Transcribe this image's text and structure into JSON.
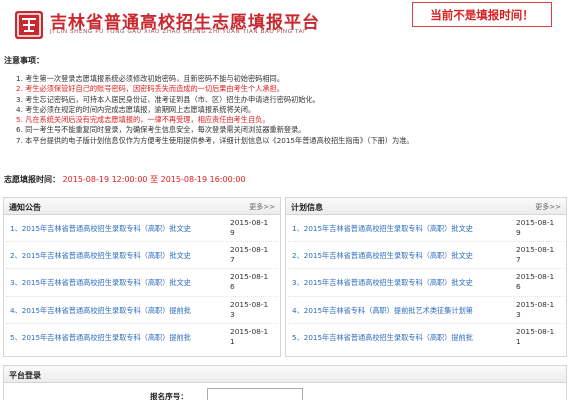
{
  "header": {
    "title": "吉林省普通高校招生志愿填报平台",
    "subtitle": "JI LIN SHENG PU TONG GAO XIAO ZHAO SHENG ZHI YUAN TIAN BAO PING TAI",
    "status_notice": "当前不是填报时间！"
  },
  "notes": {
    "title": "注意事项：",
    "items": [
      {
        "text": "1. 考生第一次登录志愿填报系统必须修改初始密码，且新密码不能与初始密码相同。",
        "red": false
      },
      {
        "text": "2. 考生必须保管好自己的账号密码，因密码丢失而造成的一切后果由考生个人承担。",
        "red": true
      },
      {
        "text": "3. 考生忘记密码后，可持本人居民身份证、准考证到县（市、区）招生办申请进行密码初始化。",
        "red": false
      },
      {
        "text": "4. 考生必须在规定的时间内完成志愿填报，逾期网上志愿填报系统将关闭。",
        "red": false
      },
      {
        "text": "5. 凡在系统关闭后没有完成志愿填报的，一律不再受理，相应责任由考生自负。",
        "red": true
      },
      {
        "text": "6. 同一考生号不能重复同时登录，为确保考生信息安全，每次登录需关闭浏览器重新登录。",
        "red": false
      },
      {
        "text": "7. 本平台提供的电子版计划信息仅作为方便考生使用提供参考，详细计划信息以《2015年普通高校招生指南》（下册）为准。",
        "red": false
      }
    ]
  },
  "period": {
    "label": "志愿填报时间：",
    "start": "2015-08-19 12:00:00",
    "sep": "至",
    "end": "2015-08-19 16:00:00"
  },
  "announcements": {
    "title": "通知公告",
    "more": "更多>>",
    "items": [
      {
        "title": "1、2015年吉林省普通高校招生录取专科（高职）批文史",
        "date": "2015-08-19"
      },
      {
        "title": "2、2015年吉林省普通高校招生录取专科（高职）批文史",
        "date": "2015-08-17"
      },
      {
        "title": "3、2015年吉林省普通高校招生录取专科（高职）批文史",
        "date": "2015-08-16"
      },
      {
        "title": "4、2015年吉林省普通高校招生录取专科（高职）提前批",
        "date": "2015-08-13"
      },
      {
        "title": "5、2015年吉林省普通高校招生录取专科（高职）提前批",
        "date": "2015-08-11"
      }
    ]
  },
  "plans": {
    "title": "计划信息",
    "more": "更多>>",
    "items": [
      {
        "title": "1、2015年吉林省普通高校招生录取专科（高职）批文史",
        "date": "2015-08-19"
      },
      {
        "title": "2、2015年吉林省普通高校招生录取专科（高职）批文史",
        "date": "2015-08-17"
      },
      {
        "title": "3、2015年吉林省普通高校招生录取专科（高职）批文史",
        "date": "2015-08-16"
      },
      {
        "title": "4、2015年吉林省专科（高职）提前批艺术类征集计划第",
        "date": "2015-08-13"
      },
      {
        "title": "5、2015年吉林省普通高校招生录取专科（高职）提前批",
        "date": "2015-08-11"
      }
    ]
  },
  "login": {
    "title": "平台登录",
    "exam_no_label": "报名序号：",
    "exam_no_value": ""
  },
  "colors": {
    "brand_red": "#c8282e",
    "alert_red": "#e02020",
    "link_blue": "#2c6bbd"
  },
  "icons": {
    "logo": "jilin-seal-logo-icon"
  }
}
